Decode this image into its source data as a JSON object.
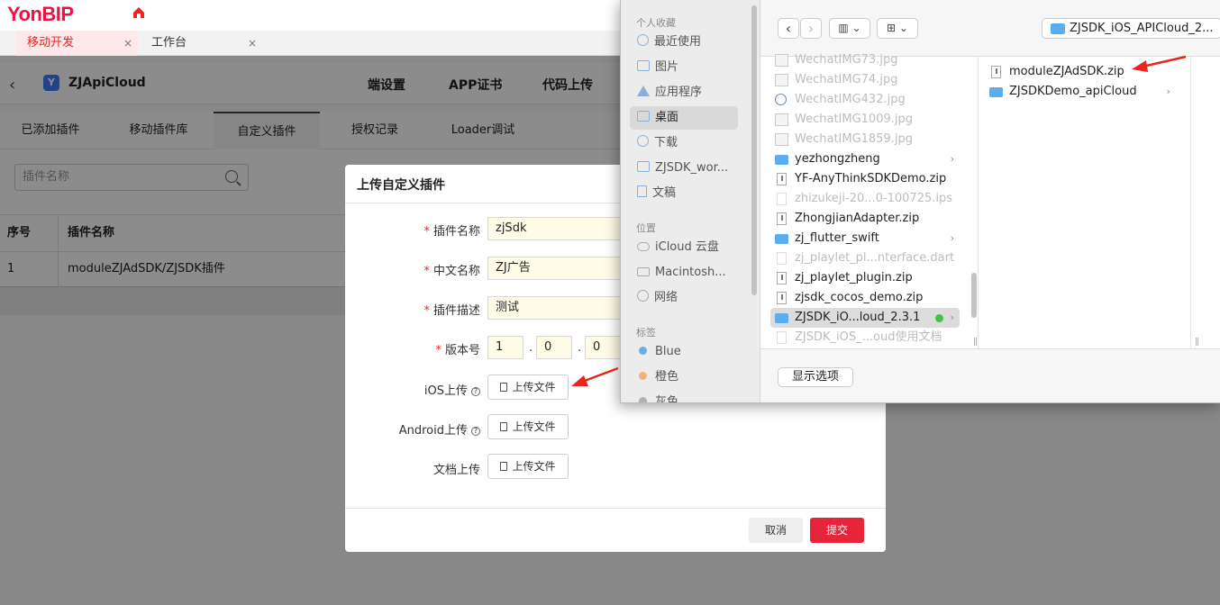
{
  "browser": {
    "logo": "YonBIP",
    "tabs": [
      {
        "label": "移动开发",
        "close": "×"
      },
      {
        "label": "工作台",
        "close": "×"
      }
    ]
  },
  "app": {
    "back_icon": "chevron-left-icon",
    "logo_letter": "Y",
    "title": "ZJApiCloud",
    "top_nav": [
      "端设置",
      "APP证书",
      "代码上传"
    ],
    "sub_tabs": [
      "已添加插件",
      "移动插件库",
      "自定义插件",
      "授权记录",
      "Loader调试"
    ],
    "active_sub_tab": "自定义插件",
    "search": {
      "placeholder": "插件名称"
    },
    "table": {
      "headers": [
        "序号",
        "插件名称"
      ],
      "rows": [
        [
          "1",
          "moduleZJAdSDK/ZJSDK插件"
        ]
      ]
    }
  },
  "modal": {
    "title": "上传自定义插件",
    "fields": {
      "name": {
        "label": "插件名称",
        "value": "zjSdk"
      },
      "cn_name": {
        "label": "中文名称",
        "value": "ZJ广告"
      },
      "desc": {
        "label": "插件描述",
        "value": "测试"
      },
      "version": {
        "label": "版本号",
        "values": [
          "1",
          "0",
          "0"
        ],
        "sep": "."
      }
    },
    "required_mark": "*",
    "uploads": {
      "ios": {
        "label": "iOS上传",
        "button": "上传文件"
      },
      "android": {
        "label": "Android上传",
        "button": "上传文件"
      },
      "docs": {
        "label": "文档上传",
        "button": "上传文件"
      }
    },
    "help_glyph": "?",
    "cancel": "取消",
    "submit": "提交",
    "accent_color": "#e6243a"
  },
  "finder": {
    "sidebar": {
      "favorites_header": "个人收藏",
      "favorites": [
        {
          "label": "最近使用",
          "icon": "clock-icon"
        },
        {
          "label": "图片",
          "icon": "photos-icon"
        },
        {
          "label": "应用程序",
          "icon": "applications-icon"
        },
        {
          "label": "桌面",
          "icon": "desktop-icon"
        },
        {
          "label": "下载",
          "icon": "download-icon"
        },
        {
          "label": "ZJSDK_wor...",
          "icon": "folder-icon"
        },
        {
          "label": "文稿",
          "icon": "documents-icon"
        }
      ],
      "locations_header": "位置",
      "locations": [
        {
          "label": "iCloud 云盘",
          "icon": "cloud-icon"
        },
        {
          "label": "Macintosh...",
          "icon": "disk-icon"
        },
        {
          "label": "网络",
          "icon": "network-icon"
        }
      ],
      "tags_header": "标签",
      "tags": [
        {
          "label": "Blue",
          "color": "#6aaee8"
        },
        {
          "label": "橙色",
          "color": "#f0b27a"
        },
        {
          "label": "灰色",
          "color": "#b0b0b0"
        }
      ]
    },
    "toolbar": {
      "back": "‹",
      "forward": "›",
      "view": "▥ ⌄",
      "grid": "⊞ ⌄",
      "path": "ZJSDK_iOS_APICloud_2..."
    },
    "column1": [
      {
        "name": "WechatIMG73.jpg",
        "kind": "img",
        "dim": true
      },
      {
        "name": "WechatIMG74.jpg",
        "kind": "img",
        "dim": true
      },
      {
        "name": "WechatIMG432.jpg",
        "kind": "round",
        "dim": true
      },
      {
        "name": "WechatIMG1009.jpg",
        "kind": "img",
        "dim": true
      },
      {
        "name": "WechatIMG1859.jpg",
        "kind": "img",
        "dim": true
      },
      {
        "name": "yezhongzheng",
        "kind": "folder",
        "dim": false,
        "chevron": true
      },
      {
        "name": "YF-AnyThinkSDKDemo.zip",
        "kind": "zip",
        "dim": false
      },
      {
        "name": "zhizukeji-20...0-100725.ips",
        "kind": "doc",
        "dim": true
      },
      {
        "name": "ZhongjianAdapter.zip",
        "kind": "zip",
        "dim": false
      },
      {
        "name": "zj_flutter_swift",
        "kind": "folder",
        "dim": false,
        "chevron": true
      },
      {
        "name": "zj_playlet_pl...nterface.dart",
        "kind": "doc",
        "dim": true
      },
      {
        "name": "zj_playlet_plugin.zip",
        "kind": "zip",
        "dim": false
      },
      {
        "name": "zjsdk_cocos_demo.zip",
        "kind": "zip",
        "dim": false
      },
      {
        "name": "ZJSDK_iO...loud_2.3.1",
        "kind": "folder",
        "dim": false,
        "chevron": true,
        "selected": true,
        "tag": "#46c046"
      },
      {
        "name": "ZJSDK_iOS_...oud使用文档",
        "kind": "doc",
        "dim": true
      }
    ],
    "column2": [
      {
        "name": "moduleZJAdSDK.zip",
        "kind": "zip",
        "chevron": false
      },
      {
        "name": "ZJSDKDemo_apiCloud",
        "kind": "folder",
        "chevron": true
      }
    ],
    "chevron": "›",
    "options_button": "显示选项"
  }
}
